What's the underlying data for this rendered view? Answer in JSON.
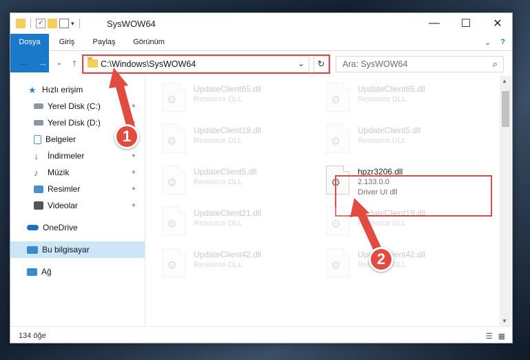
{
  "window": {
    "title": "SysWOW64",
    "controls": {
      "minimize": "—",
      "maximize": "☐",
      "close": "✕"
    }
  },
  "ribbon": {
    "tabs": [
      "Dosya",
      "Giriş",
      "Paylaş",
      "Görünüm"
    ],
    "expand_icon": "⌄",
    "help_icon": "?"
  },
  "navigation": {
    "back": "←",
    "forward": "→",
    "recent": "⌄",
    "up": "↑",
    "address": "C:\\Windows\\SysWOW64",
    "address_dropdown": "⌄",
    "refresh": "↻",
    "search_placeholder": "Ara: SysWOW64",
    "search_icon": "⌕"
  },
  "sidebar": {
    "items": [
      {
        "label": "Hızlı erişim",
        "icon": "star-icon",
        "color": "#2b7fd4",
        "pinned": false
      },
      {
        "label": "Yerel Disk (C:)",
        "icon": "drive-icon",
        "color": "#6c7a89",
        "pinned": true
      },
      {
        "label": "Yerel Disk (D:)",
        "icon": "drive-icon",
        "color": "#6c7a89",
        "pinned": true
      },
      {
        "label": "Belgeler",
        "icon": "documents-icon",
        "color": "#5a8fd0",
        "pinned": true
      },
      {
        "label": "İndirmeler",
        "icon": "download-icon",
        "color": "#2b7fd4",
        "pinned": true
      },
      {
        "label": "Müzik",
        "icon": "music-icon",
        "color": "#2b7fd4",
        "pinned": true
      },
      {
        "label": "Resimler",
        "icon": "pictures-icon",
        "color": "#4a90c8",
        "pinned": true
      },
      {
        "label": "Videolar",
        "icon": "videos-icon",
        "color": "#555555",
        "pinned": true
      },
      {
        "label": "OneDrive",
        "icon": "cloud-icon",
        "color": "#1e6fc4",
        "pinned": false
      },
      {
        "label": "Bu bilgisayar",
        "icon": "computer-icon",
        "color": "#3a8ad0",
        "pinned": false,
        "selected": true
      },
      {
        "label": "Ağ",
        "icon": "network-icon",
        "color": "#3a8ad0",
        "pinned": false
      }
    ],
    "pin_icon": "📌"
  },
  "files": [
    {
      "name": "UpdateClient65.dll",
      "meta": "Resource DLL",
      "faded": true
    },
    {
      "name": "UpdateClient65.dll",
      "meta": "Resource DLL",
      "faded": true
    },
    {
      "name": "UpdateClient19.dll",
      "meta": "Resource DLL",
      "faded": true
    },
    {
      "name": "UpdateClient5.dll",
      "meta": "Resource DLL",
      "faded": true
    },
    {
      "name": "UpdateClient5.dll",
      "meta": "Resource DLL",
      "faded": true
    },
    {
      "name": "hpzr3206.dll",
      "version": "2.133.0.0",
      "meta": "Driver UI dll",
      "faded": false
    },
    {
      "name": "UpdateClient21.dll",
      "meta": "Resource DLL",
      "faded": true
    },
    {
      "name": "UpdateClient19.dll",
      "meta": "Resource DLL",
      "faded": true
    },
    {
      "name": "UpdateClient42.dll",
      "meta": "Resource DLL",
      "faded": true
    },
    {
      "name": "UpdateClient42.dll",
      "meta": "Resource DLL",
      "faded": true
    }
  ],
  "status": {
    "count": "134 öğe",
    "view_details_icon": "☰",
    "view_tiles_icon": "▦"
  },
  "annotations": {
    "step1": "1",
    "step2": "2",
    "accent_color": "#e24b3f"
  },
  "colors": {
    "file_tab": "#1979ca",
    "selected_nav": "#cde6f7",
    "highlight": "#d94b4b"
  }
}
